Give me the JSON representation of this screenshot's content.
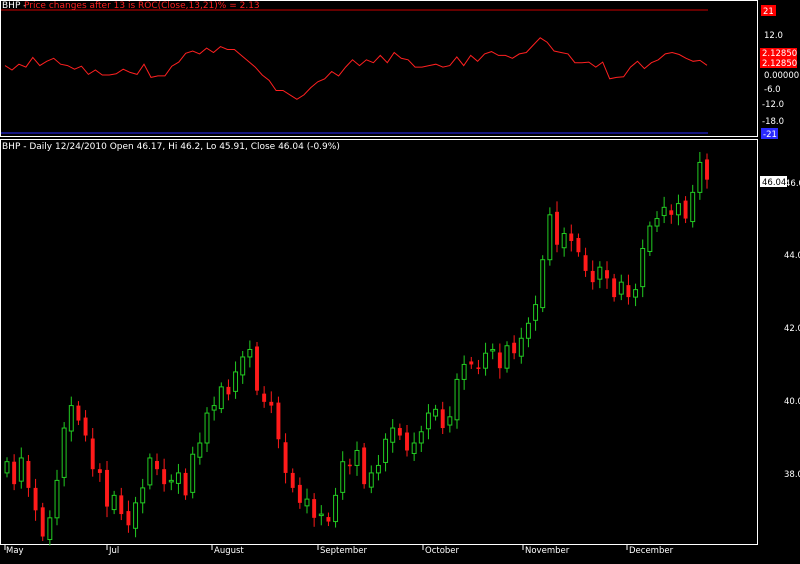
{
  "colors": {
    "background": "#000000",
    "frame": "#ffffff",
    "roc_line": "#ff2020",
    "upper_band": "#cc0000",
    "lower_band": "#2a2aff",
    "up_candle": "#22cc22",
    "down_candle": "#ff1a1a",
    "axis_text": "#ffffff"
  },
  "roc_panel": {
    "title_symbol": "BHP - ",
    "title_text": "Price changes after 13 is ROC(Close,13,21)% = 2.13",
    "upper_band_label": "21",
    "lower_band_label": "-21",
    "badge_upper": "2.12850",
    "badge_lower": "2.12850",
    "y_ticks": [
      "12.0",
      "6.0",
      "0.00000",
      "-6.0",
      "-12.0",
      "-18.0"
    ]
  },
  "price_panel": {
    "title": "BHP - Daily 12/24/2010 Open 46.17, Hi 46.2, Lo 45.91, Close 46.04 (-0.9%)",
    "last_close_label": "46.04",
    "y_ticks": [
      "46.0",
      "44.0",
      "42.0",
      "40.0",
      "38.0"
    ]
  },
  "x_axis": {
    "months": [
      "May",
      "Jul",
      "August",
      "September",
      "October",
      "November",
      "December"
    ]
  },
  "chart_data": [
    {
      "type": "line",
      "title": "BHP - Price changes after 13 is ROC(Close,13,21)% = 2.13",
      "ylim": [
        -21,
        21
      ],
      "bands": [
        21,
        -21
      ],
      "series": [
        {
          "values": [
            2.0,
            0.5,
            2.5,
            1.5,
            4.8,
            2.0,
            3.5,
            4.5,
            2.5,
            2.0,
            0.8,
            1.8,
            -1.0,
            0.5,
            -1.2,
            -1.2,
            -0.8,
            0.8,
            -0.3,
            -1.0,
            2.5,
            -2.0,
            -1.5,
            -1.5,
            1.8,
            3.2,
            6.2,
            7.0,
            6.0,
            8.0,
            6.5,
            8.5,
            7.5,
            7.5,
            5.5,
            3.5,
            1.5,
            -1.2,
            -3.0,
            -6.5,
            -6.5,
            -8.0,
            -9.5,
            -8.0,
            -5.5,
            -3.5,
            -2.5,
            0.0,
            -1.5,
            1.5,
            4.0,
            2.0,
            4.0,
            3.0,
            5.5,
            3.0,
            6.5,
            4.5,
            4.0,
            1.5,
            1.5,
            2.0,
            2.5,
            1.5,
            2.0,
            5.0,
            2.0,
            5.5,
            3.5,
            6.0,
            6.8,
            5.5,
            5.5,
            4.5,
            6.0,
            6.5,
            9.0,
            11.5,
            10.0,
            7.0,
            6.5,
            6.0,
            3.0,
            3.0,
            3.2,
            1.5,
            3.2,
            -2.5,
            -2.0,
            -1.8,
            1.5,
            3.5,
            1.0,
            3.0,
            4.0,
            6.0,
            6.5,
            5.8,
            4.5,
            3.5,
            3.8,
            2.13
          ]
        }
      ]
    },
    {
      "type": "candlestick",
      "title": "BHP - Daily 12/24/2010 Open 46.17, Hi 46.2, Lo 45.91, Close 46.04 (-0.9%)",
      "ylim": [
        36.3,
        47.1
      ],
      "x_labels": [
        "May",
        "Jul",
        "August",
        "September",
        "October",
        "November",
        "December"
      ],
      "series": [
        {
          "values": [
            38.5,
            37.9,
            38.6,
            37.8,
            37.2,
            36.5,
            37.0,
            38.0,
            39.4,
            40.0,
            39.6,
            39.2,
            38.3,
            38.2,
            37.3,
            37.6,
            37.1,
            36.8,
            37.4,
            37.8,
            38.6,
            38.3,
            37.9,
            38.0,
            38.2,
            37.6,
            38.7,
            39.0,
            39.8,
            40.0,
            40.5,
            40.3,
            40.9,
            41.3,
            41.5,
            40.4,
            40.1,
            40.0,
            39.1,
            38.2,
            37.8,
            37.4,
            37.5,
            37.0,
            37.1,
            36.9,
            37.6,
            38.5,
            38.4,
            38.8,
            37.9,
            38.2,
            38.4,
            39.1,
            39.4,
            39.2,
            38.8,
            39.0,
            39.3,
            39.8,
            39.9,
            39.4,
            39.7,
            40.7,
            41.1,
            41.1,
            41.0,
            41.4,
            41.5,
            41.0,
            41.6,
            41.4,
            41.8,
            42.2,
            42.7,
            43.9,
            45.1,
            44.3,
            44.6,
            44.4,
            44.1,
            43.6,
            43.3,
            43.7,
            43.4,
            42.9,
            43.3,
            42.9,
            43.1,
            44.2,
            44.8,
            45.0,
            45.3,
            45.1,
            45.4,
            45.0,
            45.7,
            46.5,
            46.04
          ]
        }
      ]
    }
  ]
}
